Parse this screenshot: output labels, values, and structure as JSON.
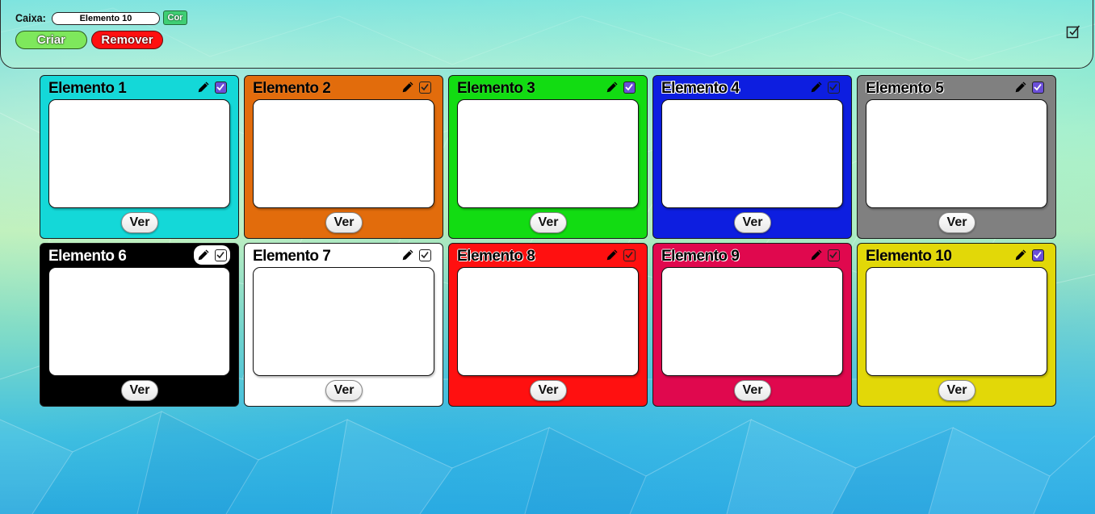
{
  "header": {
    "caixa_label": "Caixa:",
    "caixa_value": "Elemento 10",
    "cor_label": "Cor",
    "criar_label": "Criar",
    "remover_label": "Remover"
  },
  "cards": [
    {
      "title": "Elemento 1",
      "color": "#14d8d8",
      "checked": true,
      "view_label": "Ver"
    },
    {
      "title": "Elemento 2",
      "color": "#e26c0c",
      "checked": false,
      "view_label": "Ver"
    },
    {
      "title": "Elemento 3",
      "color": "#12dc12",
      "checked": true,
      "view_label": "Ver"
    },
    {
      "title": "Elemento 4",
      "color": "#0d1ee0",
      "checked": false,
      "view_label": "Ver"
    },
    {
      "title": "Elemento 5",
      "color": "#808080",
      "checked": true,
      "view_label": "Ver"
    },
    {
      "title": "Elemento 6",
      "color": "#000000",
      "checked": false,
      "view_label": "Ver"
    },
    {
      "title": "Elemento 7",
      "color": "#ffffff",
      "checked": false,
      "view_label": "Ver"
    },
    {
      "title": "Elemento 8",
      "color": "#ff1010",
      "checked": false,
      "view_label": "Ver"
    },
    {
      "title": "Elemento 9",
      "color": "#e0084e",
      "checked": false,
      "view_label": "Ver"
    },
    {
      "title": "Elemento 10",
      "color": "#e2d808",
      "checked": true,
      "view_label": "Ver"
    }
  ],
  "colors": {
    "check_fill": "#6b4fd8",
    "criar": "#7ee85c",
    "remover": "#ff1010",
    "cor": "#3fcf74"
  },
  "icons": {
    "edit": "pencil-icon",
    "select": "checkbox-icon",
    "select_all": "select-all-icon"
  }
}
